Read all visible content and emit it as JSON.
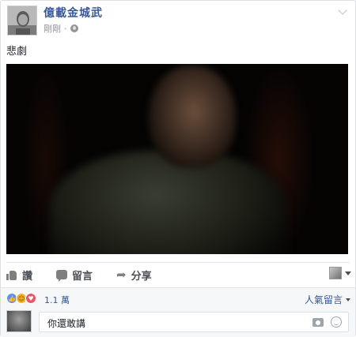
{
  "post": {
    "author": "億載金城武",
    "timestamp": "剛剛",
    "privacy_icon": "globe-icon",
    "text": "悲劇",
    "media": "video-still"
  },
  "actions": {
    "like_label": "讚",
    "comment_label": "留言",
    "share_label": "分享"
  },
  "reactions": {
    "types": [
      "like",
      "haha",
      "love"
    ],
    "count": "1.1 萬"
  },
  "comments": {
    "sort_label": "人氣留言",
    "input_value": "你還敢講"
  },
  "colors": {
    "link_blue": "#365899",
    "muted_text": "#90949c",
    "like_blue": "#5890ff",
    "love_red": "#f25268",
    "haha_yellow": "#f7b125"
  }
}
